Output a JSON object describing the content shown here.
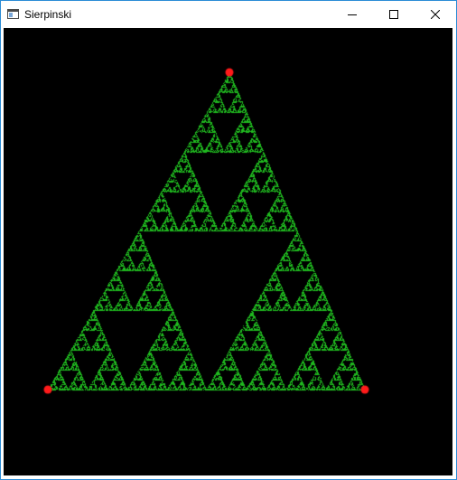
{
  "window": {
    "title": "Sierpinski",
    "app_icon": "window-app-icon",
    "controls": {
      "minimize_icon": "minimize-icon",
      "maximize_icon": "maximize-icon",
      "close_icon": "close-icon"
    }
  },
  "canvas": {
    "background_color": "#000000",
    "point_color": "#1fb81f",
    "vertex_color": "#ff1a1a",
    "vertex_count": 3
  },
  "colors": {
    "titlebar_bg": "#ffffff",
    "window_border": "#2b8cd6"
  }
}
